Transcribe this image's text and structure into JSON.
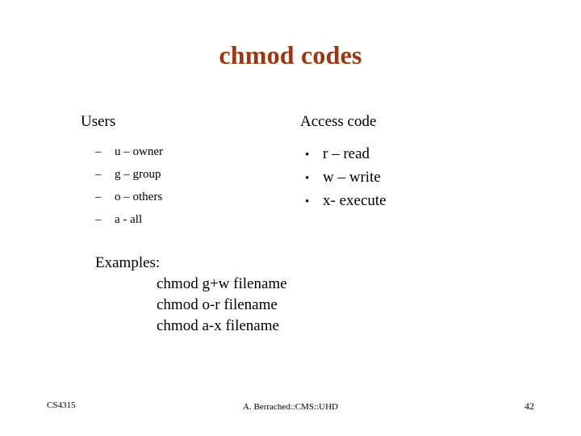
{
  "slide": {
    "title": "chmod codes",
    "accent_color": "#9e3510",
    "text_color": "#000000",
    "background": "#ffffff",
    "columns": {
      "left": {
        "heading": "Users",
        "marker": "–",
        "items": [
          {
            "label": "u – owner"
          },
          {
            "label": "g – group"
          },
          {
            "label": "o – others"
          },
          {
            "label": "a - all"
          }
        ]
      },
      "right": {
        "heading": "Access code",
        "marker": "•",
        "items": [
          {
            "label": "r – read"
          },
          {
            "label": "w – write"
          },
          {
            "label": "x- execute"
          }
        ]
      }
    },
    "examples": {
      "heading": "Examples:",
      "lines": [
        "chmod g+w filename",
        "chmod o-r filename",
        "chmod a-x filename"
      ]
    },
    "footer": {
      "left": "CS4315",
      "center": "A. Berrached::CMS::UHD",
      "page_number": "42"
    }
  }
}
